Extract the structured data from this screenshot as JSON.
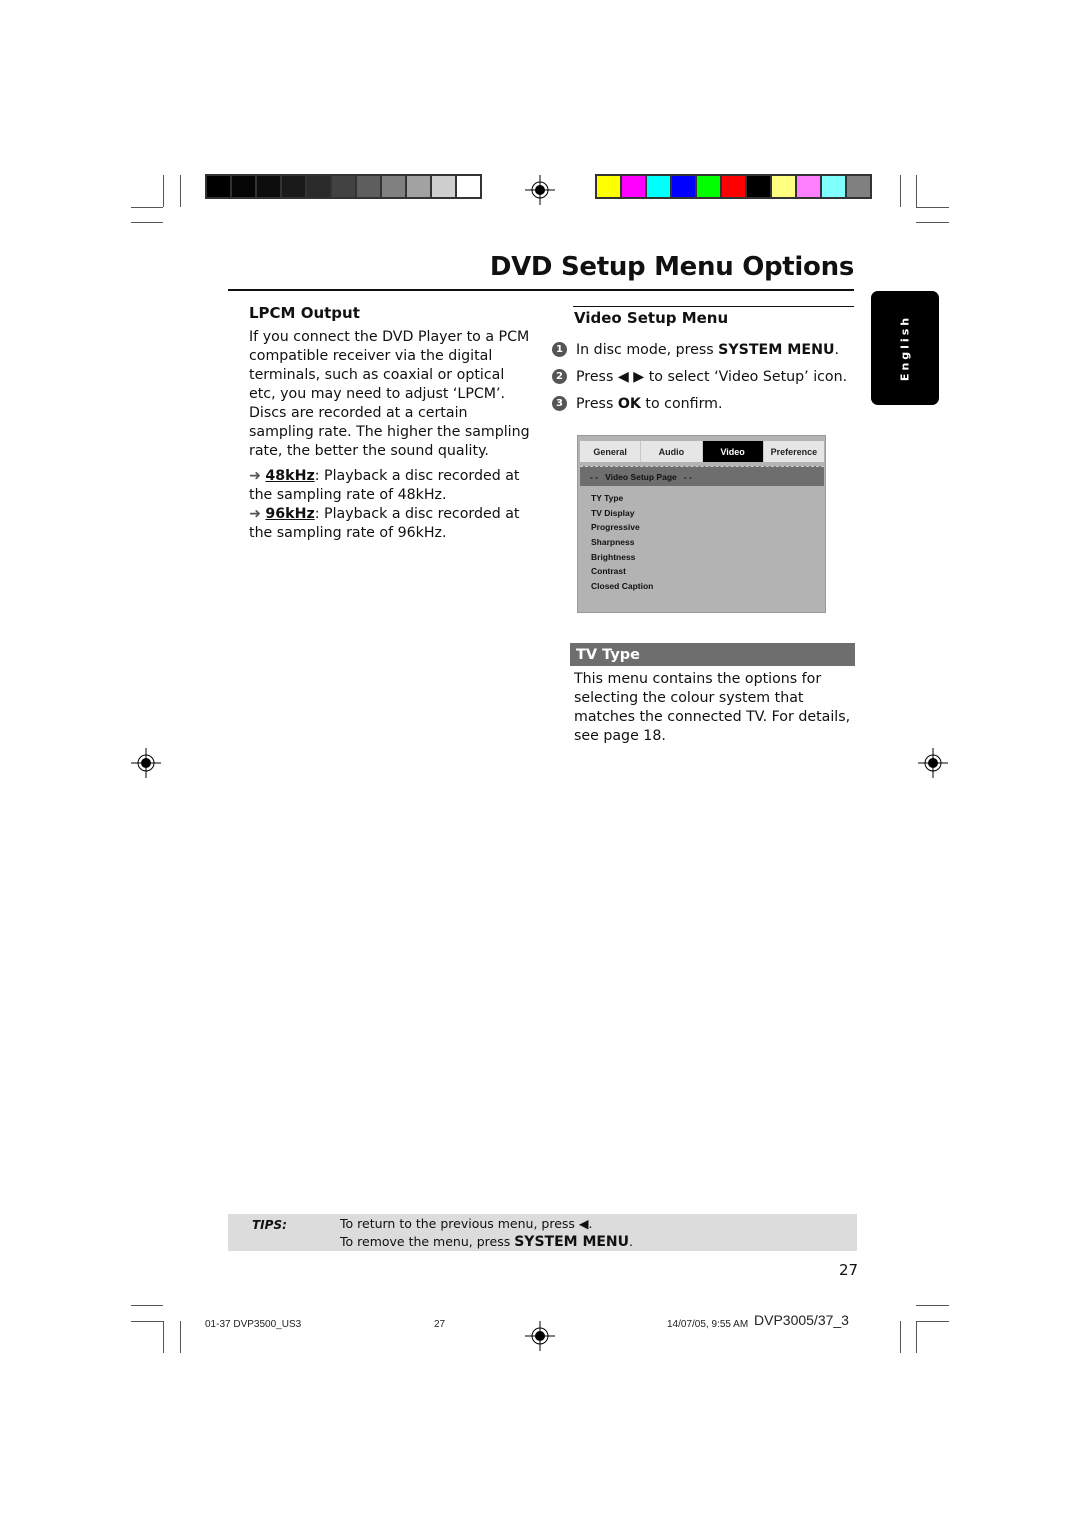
{
  "print_marks": {
    "grayscale_swatches": [
      "#000000",
      "#050505",
      "#0d0d0d",
      "#1a1a1a",
      "#2a2a2a",
      "#424242",
      "#5e5e5e",
      "#808080",
      "#a2a2a2",
      "#cfcfcf",
      "#ffffff"
    ],
    "color_swatches": [
      "#ffff00",
      "#ff00ff",
      "#00ffff",
      "#0000ff",
      "#00ff00",
      "#ff0000",
      "#000000",
      "#ffff80",
      "#ff80ff",
      "#80ffff",
      "#808080"
    ]
  },
  "header": {
    "title": "DVD Setup Menu Options"
  },
  "side_tab": {
    "label": "English"
  },
  "lpcm": {
    "heading": "LPCM Output",
    "paragraph_1": "If you connect the DVD Player to a PCM compatible receiver via the digital terminals, such as coaxial or optical etc, you may need to adjust ‘LPCM’.",
    "paragraph_2": "Discs are recorded at a certain sampling rate. The higher the sampling rate, the better the sound quality.",
    "options": [
      {
        "arrow": "➜",
        "value": "48kHz",
        "text": ": Playback a disc recorded at the sampling rate of 48kHz."
      },
      {
        "arrow": "➜",
        "value": "96kHz",
        "text": ": Playback a disc recorded at the sampling rate of 96kHz."
      }
    ]
  },
  "video_setup": {
    "heading": "Video Setup Menu",
    "steps": [
      {
        "num": "1",
        "pre": "In disc mode, press ",
        "bold": "SYSTEM MENU",
        "post": "."
      },
      {
        "num": "2",
        "pre": "Press ◀ ▶ to select ‘Video Setup’ icon.",
        "bold": "",
        "post": ""
      },
      {
        "num": "3",
        "pre": "Press ",
        "bold": "OK",
        "post": " to confirm."
      }
    ],
    "menu_screen": {
      "tabs": [
        {
          "label": "General",
          "active": false
        },
        {
          "label": "Audio",
          "active": false
        },
        {
          "label": "Video",
          "active": true
        },
        {
          "label": "Preference",
          "active": false
        }
      ],
      "page_title": "- -   Video Setup Page   - -",
      "items": [
        "TY Type",
        "TV Display",
        "Progressive",
        "Sharpness",
        "Brightness",
        "Contrast",
        "Closed Caption"
      ]
    }
  },
  "tv_type": {
    "heading": "TV Type",
    "text": "This menu contains the options for selecting the colour system that matches the connected TV.  For details, see page 18."
  },
  "tips": {
    "label": "TIPS:",
    "line_1": "To return to the previous menu, press ◀.",
    "line_2_pre": "To remove the menu, press ",
    "line_2_bold": "SYSTEM MENU",
    "line_2_post": "."
  },
  "page_number": "27",
  "footer": {
    "file": "01-37 DVP3500_US3",
    "page": "27",
    "timestamp": "14/07/05, 9:55 AM",
    "model": "DVP3005/37_3"
  }
}
